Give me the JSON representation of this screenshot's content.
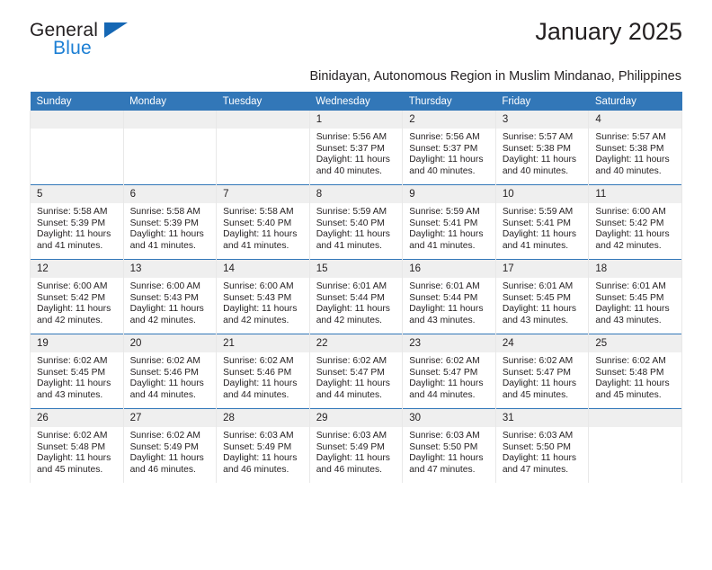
{
  "brand": {
    "name_top": "General",
    "name_bottom": "Blue",
    "triangle_color": "#1567b4",
    "blue_color": "#1c7fd4"
  },
  "header": {
    "month_title": "January 2025",
    "location_subtitle": "Binidayan, Autonomous Region in Muslim Mindanao, Philippines"
  },
  "theme": {
    "header_row_bg": "#3277b8",
    "header_row_text": "#ffffff",
    "daynum_bg": "#efefef",
    "row_divider": "#3277b8",
    "cell_border": "#e8e8e8",
    "text": "#231f20"
  },
  "calendar": {
    "weekday_headers": [
      "Sunday",
      "Monday",
      "Tuesday",
      "Wednesday",
      "Thursday",
      "Friday",
      "Saturday"
    ],
    "labels": {
      "sunrise_prefix": "Sunrise:",
      "sunset_prefix": "Sunset:",
      "daylight_prefix": "Daylight:"
    },
    "weeks": [
      [
        {
          "day": "",
          "blank": true
        },
        {
          "day": "",
          "blank": true
        },
        {
          "day": "",
          "blank": true
        },
        {
          "day": "1",
          "sunrise": "Sunrise: 5:56 AM",
          "sunset": "Sunset: 5:37 PM",
          "daylight_line1": "Daylight: 11 hours",
          "daylight_line2": "and 40 minutes."
        },
        {
          "day": "2",
          "sunrise": "Sunrise: 5:56 AM",
          "sunset": "Sunset: 5:37 PM",
          "daylight_line1": "Daylight: 11 hours",
          "daylight_line2": "and 40 minutes."
        },
        {
          "day": "3",
          "sunrise": "Sunrise: 5:57 AM",
          "sunset": "Sunset: 5:38 PM",
          "daylight_line1": "Daylight: 11 hours",
          "daylight_line2": "and 40 minutes."
        },
        {
          "day": "4",
          "sunrise": "Sunrise: 5:57 AM",
          "sunset": "Sunset: 5:38 PM",
          "daylight_line1": "Daylight: 11 hours",
          "daylight_line2": "and 40 minutes."
        }
      ],
      [
        {
          "day": "5",
          "sunrise": "Sunrise: 5:58 AM",
          "sunset": "Sunset: 5:39 PM",
          "daylight_line1": "Daylight: 11 hours",
          "daylight_line2": "and 41 minutes."
        },
        {
          "day": "6",
          "sunrise": "Sunrise: 5:58 AM",
          "sunset": "Sunset: 5:39 PM",
          "daylight_line1": "Daylight: 11 hours",
          "daylight_line2": "and 41 minutes."
        },
        {
          "day": "7",
          "sunrise": "Sunrise: 5:58 AM",
          "sunset": "Sunset: 5:40 PM",
          "daylight_line1": "Daylight: 11 hours",
          "daylight_line2": "and 41 minutes."
        },
        {
          "day": "8",
          "sunrise": "Sunrise: 5:59 AM",
          "sunset": "Sunset: 5:40 PM",
          "daylight_line1": "Daylight: 11 hours",
          "daylight_line2": "and 41 minutes."
        },
        {
          "day": "9",
          "sunrise": "Sunrise: 5:59 AM",
          "sunset": "Sunset: 5:41 PM",
          "daylight_line1": "Daylight: 11 hours",
          "daylight_line2": "and 41 minutes."
        },
        {
          "day": "10",
          "sunrise": "Sunrise: 5:59 AM",
          "sunset": "Sunset: 5:41 PM",
          "daylight_line1": "Daylight: 11 hours",
          "daylight_line2": "and 41 minutes."
        },
        {
          "day": "11",
          "sunrise": "Sunrise: 6:00 AM",
          "sunset": "Sunset: 5:42 PM",
          "daylight_line1": "Daylight: 11 hours",
          "daylight_line2": "and 42 minutes."
        }
      ],
      [
        {
          "day": "12",
          "sunrise": "Sunrise: 6:00 AM",
          "sunset": "Sunset: 5:42 PM",
          "daylight_line1": "Daylight: 11 hours",
          "daylight_line2": "and 42 minutes."
        },
        {
          "day": "13",
          "sunrise": "Sunrise: 6:00 AM",
          "sunset": "Sunset: 5:43 PM",
          "daylight_line1": "Daylight: 11 hours",
          "daylight_line2": "and 42 minutes."
        },
        {
          "day": "14",
          "sunrise": "Sunrise: 6:00 AM",
          "sunset": "Sunset: 5:43 PM",
          "daylight_line1": "Daylight: 11 hours",
          "daylight_line2": "and 42 minutes."
        },
        {
          "day": "15",
          "sunrise": "Sunrise: 6:01 AM",
          "sunset": "Sunset: 5:44 PM",
          "daylight_line1": "Daylight: 11 hours",
          "daylight_line2": "and 42 minutes."
        },
        {
          "day": "16",
          "sunrise": "Sunrise: 6:01 AM",
          "sunset": "Sunset: 5:44 PM",
          "daylight_line1": "Daylight: 11 hours",
          "daylight_line2": "and 43 minutes."
        },
        {
          "day": "17",
          "sunrise": "Sunrise: 6:01 AM",
          "sunset": "Sunset: 5:45 PM",
          "daylight_line1": "Daylight: 11 hours",
          "daylight_line2": "and 43 minutes."
        },
        {
          "day": "18",
          "sunrise": "Sunrise: 6:01 AM",
          "sunset": "Sunset: 5:45 PM",
          "daylight_line1": "Daylight: 11 hours",
          "daylight_line2": "and 43 minutes."
        }
      ],
      [
        {
          "day": "19",
          "sunrise": "Sunrise: 6:02 AM",
          "sunset": "Sunset: 5:45 PM",
          "daylight_line1": "Daylight: 11 hours",
          "daylight_line2": "and 43 minutes."
        },
        {
          "day": "20",
          "sunrise": "Sunrise: 6:02 AM",
          "sunset": "Sunset: 5:46 PM",
          "daylight_line1": "Daylight: 11 hours",
          "daylight_line2": "and 44 minutes."
        },
        {
          "day": "21",
          "sunrise": "Sunrise: 6:02 AM",
          "sunset": "Sunset: 5:46 PM",
          "daylight_line1": "Daylight: 11 hours",
          "daylight_line2": "and 44 minutes."
        },
        {
          "day": "22",
          "sunrise": "Sunrise: 6:02 AM",
          "sunset": "Sunset: 5:47 PM",
          "daylight_line1": "Daylight: 11 hours",
          "daylight_line2": "and 44 minutes."
        },
        {
          "day": "23",
          "sunrise": "Sunrise: 6:02 AM",
          "sunset": "Sunset: 5:47 PM",
          "daylight_line1": "Daylight: 11 hours",
          "daylight_line2": "and 44 minutes."
        },
        {
          "day": "24",
          "sunrise": "Sunrise: 6:02 AM",
          "sunset": "Sunset: 5:47 PM",
          "daylight_line1": "Daylight: 11 hours",
          "daylight_line2": "and 45 minutes."
        },
        {
          "day": "25",
          "sunrise": "Sunrise: 6:02 AM",
          "sunset": "Sunset: 5:48 PM",
          "daylight_line1": "Daylight: 11 hours",
          "daylight_line2": "and 45 minutes."
        }
      ],
      [
        {
          "day": "26",
          "sunrise": "Sunrise: 6:02 AM",
          "sunset": "Sunset: 5:48 PM",
          "daylight_line1": "Daylight: 11 hours",
          "daylight_line2": "and 45 minutes."
        },
        {
          "day": "27",
          "sunrise": "Sunrise: 6:02 AM",
          "sunset": "Sunset: 5:49 PM",
          "daylight_line1": "Daylight: 11 hours",
          "daylight_line2": "and 46 minutes."
        },
        {
          "day": "28",
          "sunrise": "Sunrise: 6:03 AM",
          "sunset": "Sunset: 5:49 PM",
          "daylight_line1": "Daylight: 11 hours",
          "daylight_line2": "and 46 minutes."
        },
        {
          "day": "29",
          "sunrise": "Sunrise: 6:03 AM",
          "sunset": "Sunset: 5:49 PM",
          "daylight_line1": "Daylight: 11 hours",
          "daylight_line2": "and 46 minutes."
        },
        {
          "day": "30",
          "sunrise": "Sunrise: 6:03 AM",
          "sunset": "Sunset: 5:50 PM",
          "daylight_line1": "Daylight: 11 hours",
          "daylight_line2": "and 47 minutes."
        },
        {
          "day": "31",
          "sunrise": "Sunrise: 6:03 AM",
          "sunset": "Sunset: 5:50 PM",
          "daylight_line1": "Daylight: 11 hours",
          "daylight_line2": "and 47 minutes."
        },
        {
          "day": "",
          "blank": true
        }
      ]
    ]
  }
}
